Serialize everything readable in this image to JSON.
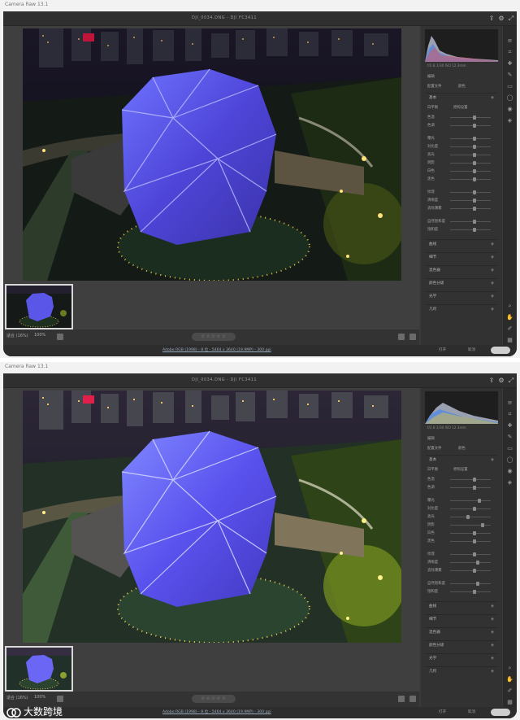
{
  "app_title": "Camera Raw 13.1",
  "file_name": "DJI_0034.DNG - DJI FC3411",
  "zoom": "适合 (16%)",
  "zoom_pct": "100%",
  "stars": "☆☆☆☆☆",
  "footer_info": "Adobe RGB (1998) - 8 位 - 5464 x 3640 (19.9MP) - 300 ppi",
  "buttons": {
    "open": "打开",
    "cancel": "取消",
    "done": "完成"
  },
  "histogram_caption": "f/2.8  1/30  ISO  12.3mm",
  "panel": {
    "header": "编辑",
    "profile_label": "配置文件",
    "profile_value": "颜色",
    "basic": "基本",
    "white_balance_label": "白平衡",
    "white_balance_value": "原照设置",
    "sliders": [
      "色温",
      "色调",
      "曝光",
      "对比度",
      "高光",
      "阴影",
      "白色",
      "黑色",
      "纹理",
      "清晰度",
      "去除薄雾",
      "自然饱和度",
      "饱和度"
    ],
    "sections": [
      "曲线",
      "细节",
      "混色器",
      "颜色分级",
      "光学",
      "几何"
    ]
  },
  "watermark": "大数跨境",
  "colors": {
    "accent": "#3b82f6",
    "panel": "#323232"
  },
  "icons": [
    "zoom-icon",
    "hand-icon",
    "color-sampler-icon",
    "grid-icon",
    "settings-icon",
    "fullscreen-icon"
  ]
}
